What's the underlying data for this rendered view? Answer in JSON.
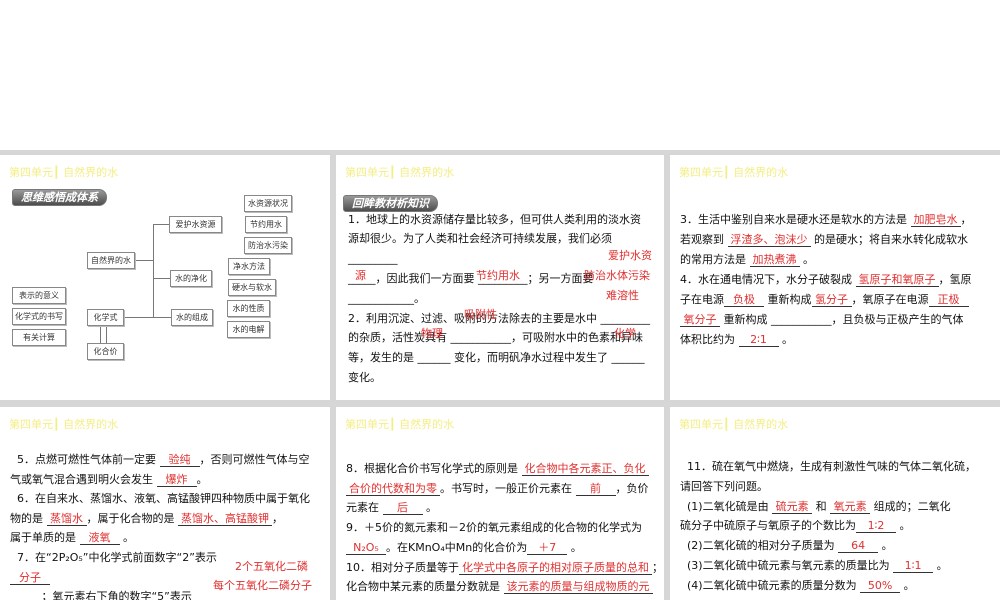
{
  "header": "第四单元┃ 自然界的水",
  "panel1": {
    "badge": "思维感悟成体系",
    "boxes": {
      "water_resources_status": "水资源状况",
      "save_water": "节约用水",
      "prevent_pollution": "防治水污染",
      "purify_methods": "净水方法",
      "hard_soft": "硬水与软水",
      "water_properties": "水的性质",
      "electrolysis": "水的电解",
      "protect_water": "爱护水资源",
      "nature_water": "自然界的水",
      "purification": "水的净化",
      "composition": "水的组成",
      "formula": "化学式",
      "valence": "化合价",
      "meaning": "表示的意义",
      "writing": "化学式的书写",
      "calc": "有关计算"
    }
  },
  "panel2": {
    "badge": "回眸教材析知识",
    "lines": [
      "1．地球上的水资源储存量比较多，但可供人类利用的淡水资",
      "源却很少。为了人类和社会经济可持续发展，我们必须",
      "_________",
      "_____，因此我们一方面要 _________；另一方面要",
      "____________。",
      "2．利用沉淀、过滤、吸附的方法除去的主要是水中 _________",
      "的杂质，活性炭具有 ___________，可吸附水中的色素和异味",
      "等，发生的是 ______ 变化，而明矾净水过程中发生了 ______",
      "变化。"
    ],
    "answers": {
      "a1": "爱护水资",
      "a2": "源",
      "a3": "节约用水",
      "a4": "防治水体污染",
      "a5": "难溶性",
      "a6": "吸附性",
      "a7": "物理",
      "a8": "化学"
    }
  },
  "panel3": {
    "lines": [
      [
        {
          "t": "3．生活中鉴别自来水是硬水还是软水的方法是 "
        },
        {
          "a": "加肥皂水"
        },
        {
          "t": "，"
        }
      ],
      [
        {
          "t": "若观察到 "
        },
        {
          "a": "浮渣多、泡沫少"
        },
        {
          "t": " 的是硬水；将自来水转化成软水"
        }
      ],
      [
        {
          "t": "的常用方法是 "
        },
        {
          "a": "加热煮沸"
        },
        {
          "t": " 。"
        }
      ],
      [
        {
          "t": "4．水在通电情况下，水分子破裂成 "
        },
        {
          "a": "氢原子和氧原子"
        },
        {
          "t": "，氢原"
        }
      ],
      [
        {
          "t": "子在电源"
        },
        {
          "a": "负极"
        },
        {
          "t": " 重新构成"
        },
        {
          "a": "氢分子"
        },
        {
          "t": "，氧原子在电源"
        },
        {
          "a": "正极"
        }
      ],
      [
        {
          "a": "氧分子"
        },
        {
          "t": " 重新构成 ___________，且负极与正极产生的气体"
        }
      ],
      [
        {
          "t": "体积比约为 "
        },
        {
          "a": "2∶1"
        },
        {
          "t": " 。"
        }
      ]
    ]
  },
  "panel4": {
    "lines": [
      [
        {
          "t": "  5．点燃可燃性气体前一定要 "
        },
        {
          "a": "验纯"
        },
        {
          "t": "，否则可燃性气体与空"
        }
      ],
      [
        {
          "t": "气或氧气混合遇到明火会发生 "
        },
        {
          "a": "爆炸"
        },
        {
          "t": "。"
        }
      ],
      [
        {
          "t": "  6．在自来水、蒸馏水、液氧、高锰酸钾四种物质中属于氧化"
        }
      ],
      [
        {
          "t": "物的是 "
        },
        {
          "a": "蒸馏水"
        },
        {
          "t": "，属于化合物的是 "
        },
        {
          "a": "蒸馏水、高锰酸钾"
        },
        {
          "t": "，"
        }
      ],
      [
        {
          "t": "属于单质的是 "
        },
        {
          "a": "液氧"
        },
        {
          "t": " 。"
        }
      ],
      [
        {
          "t": "  7．在“2P₂O₅”中化学式前面数字“2”表示"
        }
      ],
      [
        {
          "a": "分子"
        }
      ],
      [
        {
          "t": "         ；氧元素右下角的数字“5”表示"
        }
      ]
    ],
    "extra": {
      "e1": "2个五氧化二磷",
      "e2": "每个五氧化二磷分子"
    }
  },
  "panel5": {
    "lines": [
      [
        {
          "t": "8．根据化合价书写化学式的原则是 "
        },
        {
          "a": "化合物中各元素正、负化"
        }
      ],
      [
        {
          "a": "合价的代数和为零"
        },
        {
          "t": "。书写时，一般正价元素在 "
        },
        {
          "a": "前"
        },
        {
          "t": "，负价"
        }
      ],
      [
        {
          "t": "元素在 "
        },
        {
          "a": "后"
        },
        {
          "t": " 。"
        }
      ],
      [
        {
          "t": "9．＋5价的氮元素和－2价的氧元素组成的化合物的化学式为"
        }
      ],
      [
        {
          "a": "N₂O₅"
        },
        {
          "t": "。在KMnO₄中Mn的化合价为"
        },
        {
          "a": "＋7"
        },
        {
          "t": " 。"
        }
      ],
      [
        {
          "t": "10．相对分子质量等于"
        },
        {
          "a": "化学式中各原子的相对原子质量的总和"
        },
        {
          "t": "；"
        }
      ],
      [
        {
          "t": "化合物中某元素的质量分数就是 "
        },
        {
          "a": "该元素的质量与组成物质的元"
        }
      ]
    ]
  },
  "panel6": {
    "lines": [
      [
        {
          "t": "  11．硫在氧气中燃烧，生成有刺激性气味的气体二氧化硫，"
        }
      ],
      [
        {
          "t": "请回答下列问题。"
        }
      ],
      [
        {
          "t": "  (1)二氧化硫是由 "
        },
        {
          "a": "硫元素"
        },
        {
          "t": " 和 "
        },
        {
          "a": "氧元素"
        },
        {
          "t": " 组成的；二氧化"
        }
      ],
      [
        {
          "t": "硫分子中硫原子与氧原子的个数比为"
        },
        {
          "a": "1∶2"
        },
        {
          "t": " 。"
        }
      ],
      [
        {
          "t": "  (2)二氧化硫的相对分子质量为 "
        },
        {
          "a": "64"
        },
        {
          "t": " 。"
        }
      ],
      [
        {
          "t": "  (3)二氧化硫中硫元素与氧元素的质量比为 "
        },
        {
          "a": "1∶1"
        },
        {
          "t": " 。"
        }
      ],
      [
        {
          "t": "  (4)二氧化硫中硫元素的质量分数为 "
        },
        {
          "a": "50%"
        },
        {
          "t": " 。"
        }
      ]
    ]
  }
}
